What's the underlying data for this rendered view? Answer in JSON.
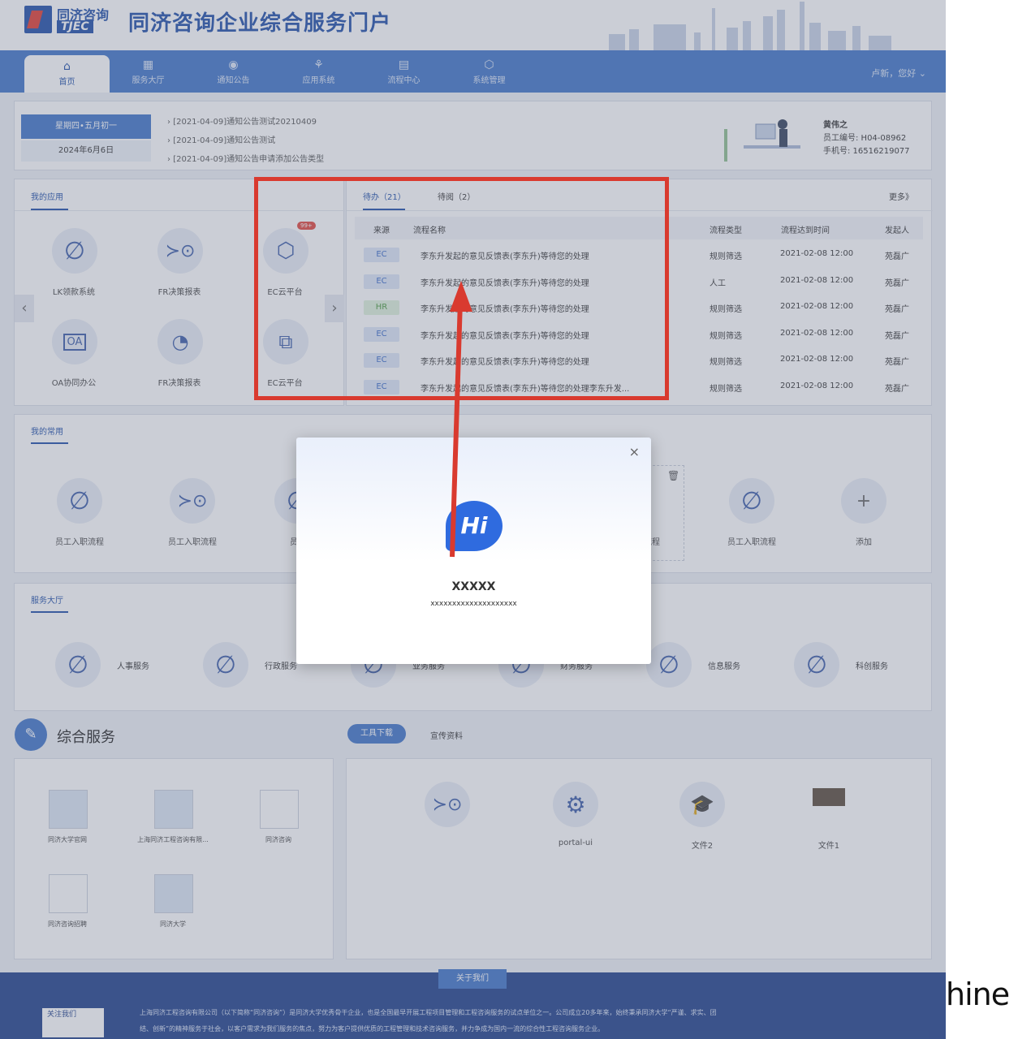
{
  "logo": {
    "line1": "同济咨询",
    "line2": "TJEC"
  },
  "portal_title": "同济咨询企业综合服务门户",
  "nav": {
    "items": [
      {
        "icon": "⌂",
        "label": "首页"
      },
      {
        "icon": "▦",
        "label": "服务大厅"
      },
      {
        "icon": "◉",
        "label": "通知公告"
      },
      {
        "icon": "⚘",
        "label": "应用系统"
      },
      {
        "icon": "▤",
        "label": "流程中心"
      },
      {
        "icon": "⬡",
        "label": "系统管理"
      }
    ],
    "user": "卢新，您好 ⌄"
  },
  "date": {
    "weekday": "星期四•五月初一",
    "date": "2024年6月6日"
  },
  "notices": [
    "[2021-04-09]通知公告测试20210409",
    "[2021-04-09]通知公告测试",
    "[2021-04-09]通知公告申请添加公告类型"
  ],
  "profile": {
    "name": "黄伟之",
    "emp": "员工编号: H04-08962",
    "phone": "手机号: 16516219077"
  },
  "my_apps": {
    "title": "我的应用",
    "badge": "99+",
    "items": [
      "LK领款系统",
      "FR决策报表",
      "EC云平台",
      "OA协同办公",
      "FR决策报表",
      "EC云平台"
    ]
  },
  "tasks": {
    "tab1": "待办（21）",
    "tab2": "待阅（2）",
    "more": "更多》",
    "headers": [
      "来源",
      "流程名称",
      "流程类型",
      "流程达到时间",
      "发起人"
    ],
    "rows": [
      {
        "src": "EC",
        "name": "李东升发起的意见反馈表(李东升)等待您的处理",
        "type": "规则筛选",
        "time": "2021-02-08 12:00",
        "by": "苑磊广"
      },
      {
        "src": "EC",
        "name": "李东升发起的意见反馈表(李东升)等待您的处理",
        "type": "人工",
        "time": "2021-02-08 12:00",
        "by": "苑磊广"
      },
      {
        "src": "HR",
        "name": "李东升发起的意见反馈表(李东升)等待您的处理",
        "type": "规则筛选",
        "time": "2021-02-08 12:00",
        "by": "苑磊广"
      },
      {
        "src": "EC",
        "name": "李东升发起的意见反馈表(李东升)等待您的处理",
        "type": "规则筛选",
        "time": "2021-02-08 12:00",
        "by": "苑磊广"
      },
      {
        "src": "EC",
        "name": "李东升发起的意见反馈表(李东升)等待您的处理",
        "type": "规则筛选",
        "time": "2021-02-08 12:00",
        "by": "苑磊广"
      },
      {
        "src": "EC",
        "name": "李东升发起的意见反馈表(李东升)等待您的处理李东升发...",
        "type": "规则筛选",
        "time": "2021-02-08 12:00",
        "by": "苑磊广"
      }
    ]
  },
  "common": {
    "title": "我的常用",
    "items": [
      "员工入职流程",
      "员工入职流程",
      "员工",
      "流程",
      "员工入职流程"
    ],
    "add": "添加"
  },
  "hall": {
    "title": "服务大厅",
    "items": [
      "人事服务",
      "行政服务",
      "业务服务",
      "财务服务",
      "信息服务",
      "科创服务"
    ]
  },
  "general": {
    "title": "综合服务",
    "tab1": "工具下载",
    "tab2": "宣传资料",
    "links": [
      "同济大学官网",
      "上海同济工程咨询有限...",
      "同济咨询",
      "同济咨询招聘",
      "同济大学"
    ],
    "tools": [
      "portal-ui",
      "文件2",
      "文件1"
    ]
  },
  "modal": {
    "badge": "Hi",
    "title": "XXXXX",
    "subtitle": "xxxxxxxxxxxxxxxxxxxx",
    "close": "×"
  },
  "footer": {
    "about": "关于我们",
    "follow": "关注我们",
    "line1": "上海同济工程咨询有限公司（以下简称“同济咨询”）是同济大学优秀骨干企业，也是全国最早开展工程项目管理和工程咨询服务的试点单位之一。公司成立20多年来，始终秉承同济大学“严谨、求实、团",
    "line2": "结、创新”的精神服务于社会，以客户需求为我们服务的焦点，努力为客户提供优质的工程管理和技术咨询服务，并力争成为国内一流的综合性工程咨询服务企业。"
  },
  "edge_text": "hine",
  "colors": {
    "brand": "#1e4ea8",
    "nav": "#3f74c9",
    "annotation": "#d93a2f"
  }
}
